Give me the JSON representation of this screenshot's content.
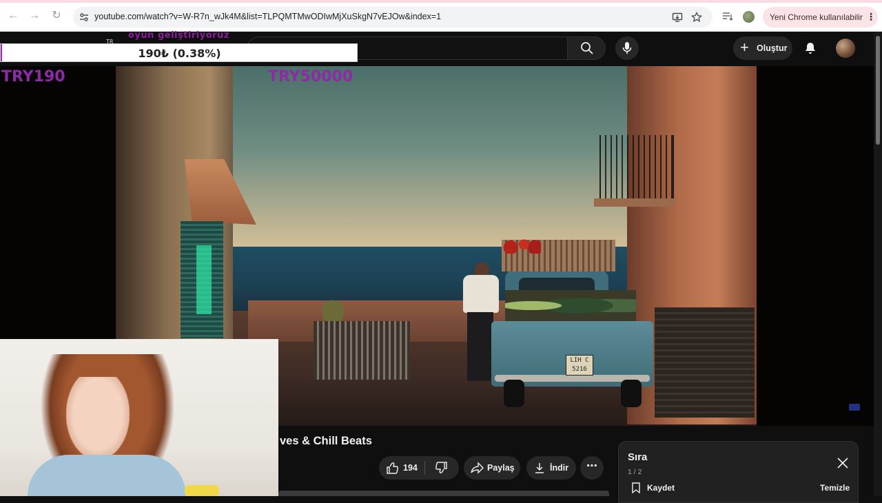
{
  "browser": {
    "url": "youtube.com/watch?v=W-R7n_wJk4M&list=TLPQMTMwODIwMjXuSkgN7vEJOw&index=1",
    "update_chip": "Yeni Chrome kullanılabilir"
  },
  "youtube_header": {
    "create_label": "Oluştur"
  },
  "overlay": {
    "top_text": "oyun geliştiriyoruz",
    "tr_tag": "TR",
    "progress_text": "190₺ (0.38%)",
    "progress_fraction": 0.0038,
    "goal_current": "TRY190",
    "goal_target": "TRY50000"
  },
  "video": {
    "plate_line1": "LIH C",
    "plate_line2": "5216",
    "title": "ves & Chill Beats"
  },
  "actions": {
    "like_count": "194",
    "share_label": "Paylaş",
    "download_label": "İndir"
  },
  "queue": {
    "title": "Sıra",
    "count": "1 / 2",
    "save_label": "Kaydet",
    "clear_label": "Temizle"
  },
  "colors": {
    "overlay_accent": "#9b29b5",
    "youtube_bg": "#0f0f0f"
  }
}
